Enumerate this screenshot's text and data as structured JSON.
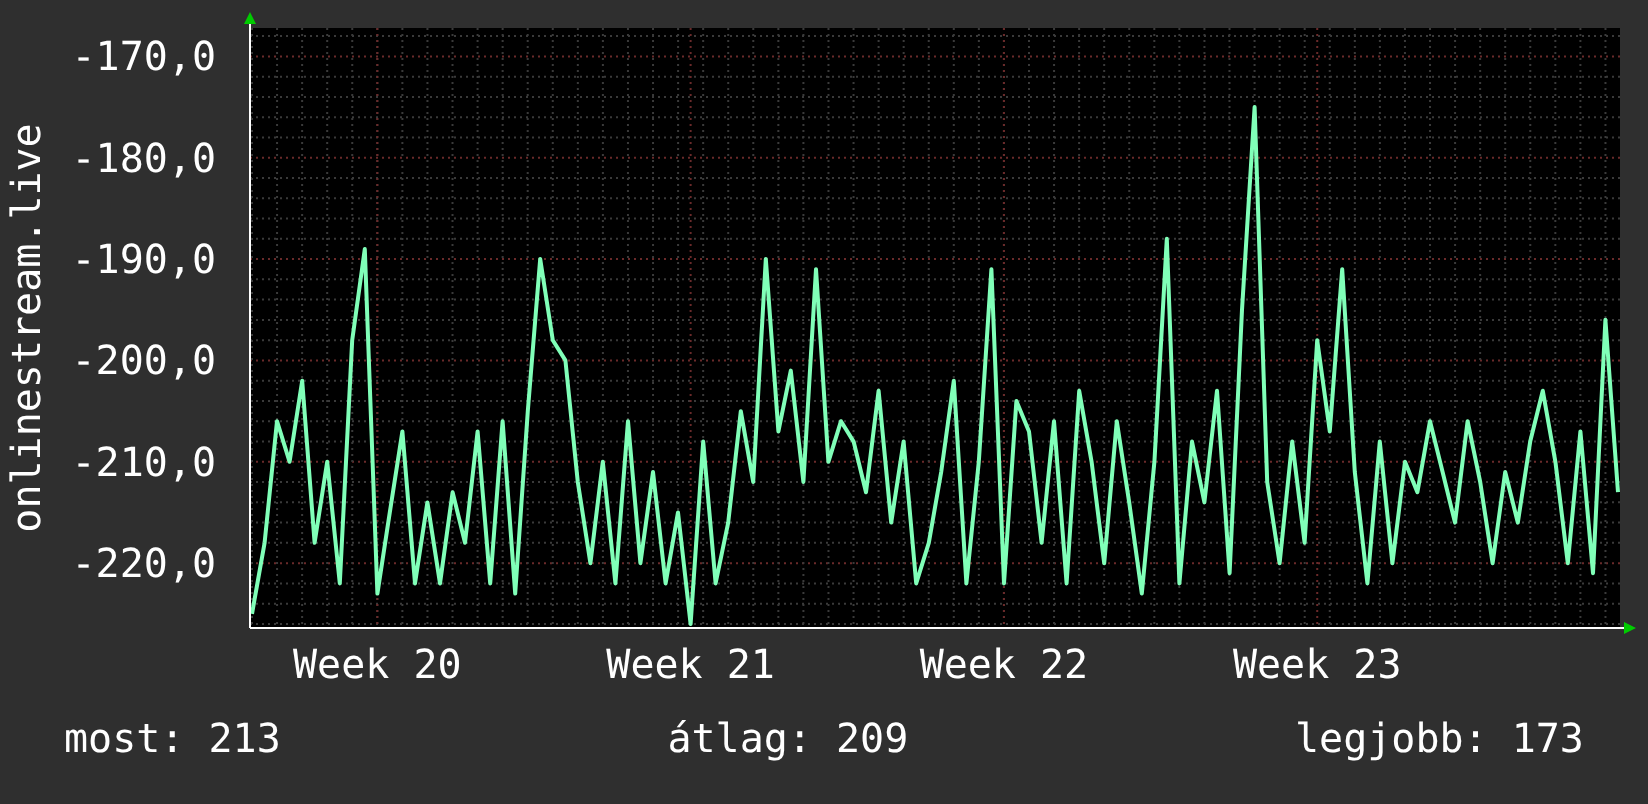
{
  "chart": {
    "chart_data": {
      "type": "line",
      "grid": true,
      "ylabel": "onlinestream.live",
      "ylim": [
        -226.4,
        -167.2
      ],
      "yticks": [
        {
          "value": -170,
          "label": "-170,0"
        },
        {
          "value": -180,
          "label": "-180,0"
        },
        {
          "value": -190,
          "label": "-190,0"
        },
        {
          "value": -200,
          "label": "-200,0"
        },
        {
          "value": -210,
          "label": "-210,0"
        },
        {
          "value": -220,
          "label": "-220,0"
        }
      ],
      "categories": [
        null,
        null,
        null,
        null,
        null,
        null,
        null,
        null,
        null,
        null,
        "Week 20",
        null,
        null,
        null,
        null,
        null,
        null,
        null,
        null,
        null,
        null,
        null,
        null,
        null,
        null,
        null,
        null,
        null,
        null,
        null,
        null,
        null,
        null,
        null,
        null,
        "Week 21",
        null,
        null,
        null,
        null,
        null,
        null,
        null,
        null,
        null,
        null,
        null,
        null,
        null,
        null,
        null,
        null,
        null,
        null,
        null,
        null,
        null,
        null,
        null,
        null,
        "Week 22",
        null,
        null,
        null,
        null,
        null,
        null,
        null,
        null,
        null,
        null,
        null,
        null,
        null,
        null,
        null,
        null,
        null,
        null,
        null,
        null,
        null,
        null,
        null,
        null,
        "Week 23",
        null,
        null,
        null,
        null,
        null,
        null,
        null,
        null,
        null,
        null,
        null,
        null,
        null,
        null,
        null,
        null,
        null,
        null,
        null,
        null,
        null,
        null,
        null,
        null
      ],
      "series": [
        {
          "color": "#80ffb8",
          "values": [
            -225,
            -218,
            -206,
            -210,
            -202,
            -218,
            -210,
            -222,
            -198,
            -189,
            -223,
            -215,
            -207,
            -222,
            -214,
            -222,
            -213,
            -218,
            -207,
            -222,
            -206,
            -223,
            -205,
            -190,
            -198,
            -200,
            -212,
            -220,
            -210,
            -222,
            -206,
            -220,
            -211,
            -222,
            -215,
            -226,
            -208,
            -222,
            -216,
            -205,
            -212,
            -190,
            -207,
            -201,
            -212,
            -191,
            -210,
            -206,
            -208,
            -213,
            -203,
            -216,
            -208,
            -222,
            -218,
            -211,
            -202,
            -222,
            -210,
            -191,
            -222,
            -204,
            -207,
            -218,
            -206,
            -222,
            -203,
            -210,
            -220,
            -206,
            -214,
            -223,
            -210,
            -188,
            -222,
            -208,
            -214,
            -203,
            -221,
            -195,
            -175,
            -212,
            -220,
            -208,
            -218,
            -198,
            -207,
            -191,
            -211,
            -222,
            -208,
            -220,
            -210,
            -213,
            -206,
            -211,
            -216,
            -206,
            -212,
            -220,
            -211,
            -216,
            -208,
            -203,
            -210,
            -220,
            -207,
            -221,
            -196,
            -213
          ]
        }
      ]
    }
  },
  "stats": [
    "most: 213",
    "átlag: 209",
    "legjobb: 173"
  ]
}
